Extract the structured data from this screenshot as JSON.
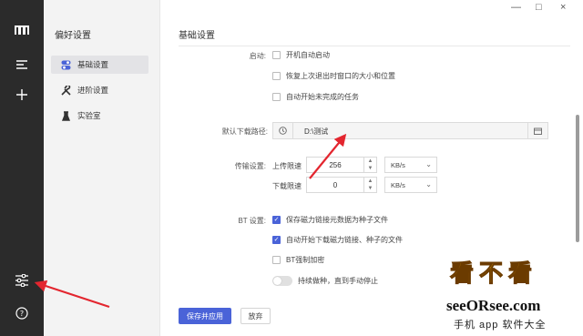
{
  "rail": {
    "icons": [
      "logo-icon",
      "menu-icon",
      "add-icon",
      "settings-sliders-icon",
      "help-icon"
    ]
  },
  "sidebar": {
    "title": "偏好设置",
    "items": [
      {
        "label": "基础设置",
        "icon": "toggle-icon",
        "active": true
      },
      {
        "label": "进阶设置",
        "icon": "tools-icon",
        "active": false
      },
      {
        "label": "实验室",
        "icon": "flask-icon",
        "active": false
      }
    ]
  },
  "window": {
    "minimize": "—",
    "maximize": "□",
    "close": "×"
  },
  "main": {
    "title": "基础设置",
    "startup": {
      "label": "启动:",
      "options": [
        {
          "label": "开机自动启动",
          "checked": false
        },
        {
          "label": "恢复上次退出时窗口的大小和位置",
          "checked": false
        },
        {
          "label": "自动开始未完成的任务",
          "checked": false
        }
      ]
    },
    "download_path": {
      "label": "默认下载路径:",
      "value": "D:\\测试"
    },
    "transfer": {
      "label": "传输设置:",
      "upload_label": "上传限速",
      "upload_value": "256",
      "upload_unit": "KB/s",
      "download_label": "下载限速",
      "download_value": "0",
      "download_unit": "KB/s"
    },
    "bt": {
      "label": "BT 设置:",
      "options": [
        {
          "label": "保存磁力链接元数据为种子文件",
          "checked": true
        },
        {
          "label": "自动开始下载磁力链接、种子的文件",
          "checked": true
        },
        {
          "label": "BT强制加密",
          "checked": false
        }
      ],
      "seeding_label": "持续做种，直到手动停止",
      "seeding_on": false
    },
    "apply_button": "保存并应用",
    "discard_button": "放弃"
  },
  "watermark": {
    "big": "看不看",
    "url": "seeORsee.com",
    "tag": "手机 app 软件大全"
  },
  "colors": {
    "accent": "#4a63d8",
    "annotation": "#e3262f",
    "rail": "#2b2b2b"
  }
}
